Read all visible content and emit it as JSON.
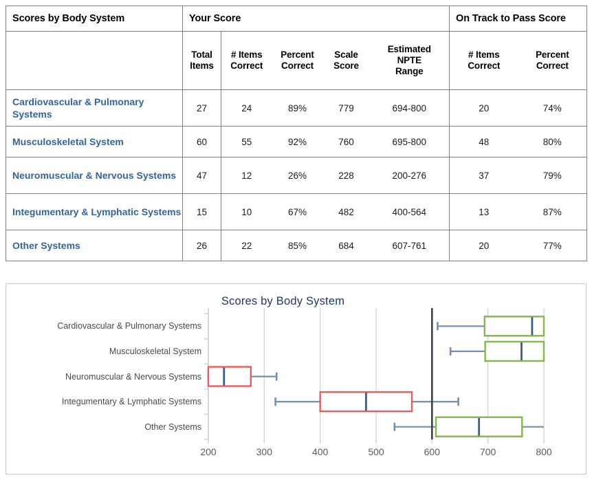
{
  "table": {
    "group_headers": [
      {
        "label": "Scores by Body System"
      },
      {
        "label": "Your Score"
      },
      {
        "label": "On Track to Pass Score"
      }
    ],
    "sub_headers": {
      "total_items": [
        "Total",
        "Items"
      ],
      "your_items_correct": [
        "# Items",
        "Correct"
      ],
      "your_percent_correct": [
        "Percent",
        "Correct"
      ],
      "scale_score": [
        "Scale",
        "Score"
      ],
      "npte_range": [
        "Estimated",
        "NPTE",
        "Range"
      ],
      "pass_items_correct": [
        "# Items",
        "Correct"
      ],
      "pass_percent_correct": [
        "Percent",
        "Correct"
      ]
    },
    "rows": [
      {
        "label": "Cardiovascular & Pulmonary Systems",
        "total_items": "27",
        "your_items_correct": "24",
        "your_percent_correct": "89%",
        "scale_score": "779",
        "npte_range": "694-800",
        "pass_items_correct": "20",
        "pass_percent_correct": "74%"
      },
      {
        "label": "Musculoskeletal System",
        "total_items": "60",
        "your_items_correct": "55",
        "your_percent_correct": "92%",
        "scale_score": "760",
        "npte_range": "695-800",
        "pass_items_correct": "48",
        "pass_percent_correct": "80%"
      },
      {
        "label": "Neuromuscular & Nervous Systems",
        "total_items": "47",
        "your_items_correct": "12",
        "your_percent_correct": "26%",
        "scale_score": "228",
        "npte_range": "200-276",
        "pass_items_correct": "37",
        "pass_percent_correct": "79%"
      },
      {
        "label": "Integumentary & Lymphatic Systems",
        "total_items": "15",
        "your_items_correct": "10",
        "your_percent_correct": "67%",
        "scale_score": "482",
        "npte_range": "400-564",
        "pass_items_correct": "13",
        "pass_percent_correct": "87%"
      },
      {
        "label": "Other Systems",
        "total_items": "26",
        "your_items_correct": "22",
        "your_percent_correct": "85%",
        "scale_score": "684",
        "npte_range": "607-761",
        "pass_items_correct": "20",
        "pass_percent_correct": "77%"
      }
    ]
  },
  "chart_data": {
    "type": "box",
    "title": "Scores by Body System",
    "xlabel": "",
    "ylabel": "",
    "xlim": [
      200,
      800
    ],
    "xticks": [
      200,
      300,
      400,
      500,
      600,
      700,
      800
    ],
    "xtick_labels": [
      "200",
      "300",
      "400",
      "500",
      "600",
      "700",
      "800"
    ],
    "grid": true,
    "legend": "none",
    "orientation": "horizontal",
    "pass_threshold": 600,
    "pass_threshold_color": "#404040",
    "pass_color": "#7FBA42",
    "fail_color": "#ED5A5A",
    "whisker_color": "#6E8FB6",
    "median_color": "#3A5D8F",
    "categories": [
      "Cardiovascular & Pulmonary Systems",
      "Musculoskeletal System",
      "Neuromuscular & Nervous Systems",
      "Integumentary & Lymphatic Systems",
      "Other Systems"
    ],
    "boxes": [
      {
        "category": "Cardiovascular & Pulmonary Systems",
        "whisker_low": 610,
        "q1": 694,
        "median": 779,
        "q3": 800,
        "whisker_high": 800,
        "status": "pass"
      },
      {
        "category": "Musculoskeletal System",
        "whisker_low": 633,
        "q1": 695,
        "median": 760,
        "q3": 800,
        "whisker_high": 800,
        "status": "pass"
      },
      {
        "category": "Neuromuscular & Nervous Systems",
        "whisker_low": 200,
        "q1": 200,
        "median": 228,
        "q3": 276,
        "whisker_high": 322,
        "status": "fail"
      },
      {
        "category": "Integumentary & Lymphatic Systems",
        "whisker_low": 320,
        "q1": 400,
        "median": 482,
        "q3": 564,
        "whisker_high": 647,
        "status": "fail"
      },
      {
        "category": "Other Systems",
        "whisker_low": 533,
        "q1": 607,
        "median": 684,
        "q3": 761,
        "whisker_high": 800,
        "status": "pass"
      }
    ]
  }
}
